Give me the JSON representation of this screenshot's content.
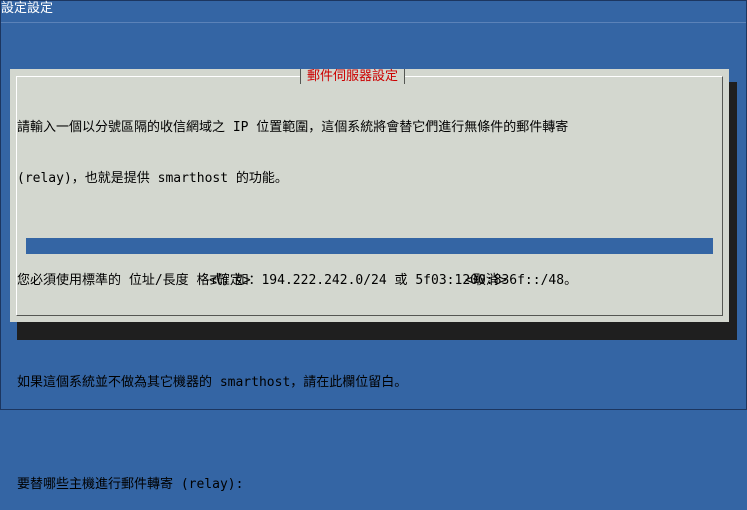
{
  "backtitle": "設定設定",
  "dialog": {
    "title": "郵件伺服器設定",
    "lines": [
      "請輸入一個以分號區隔的收信網域之 IP 位置範圍，這個系統將會替它們進行無條件的郵件轉寄",
      "(relay)，也就是提供 smarthost 的功能。",
      "您必須使用標準的 位址/長度 格式，如：194.222.242.0/24 或 5f03:1200:836f::/48。",
      "如果這個系統並不做為其它機器的 smarthost，請在此欄位留白。",
      "要替哪些主機進行郵件轉寄 (relay):"
    ],
    "input_value": "",
    "ok_label": "<確定>",
    "cancel_label": "<取消>"
  },
  "colors": {
    "desktop": "#3465a4",
    "dialog_bg": "#d3d7cf",
    "title": "#cc0000",
    "shadow": "#1f1f1f"
  }
}
